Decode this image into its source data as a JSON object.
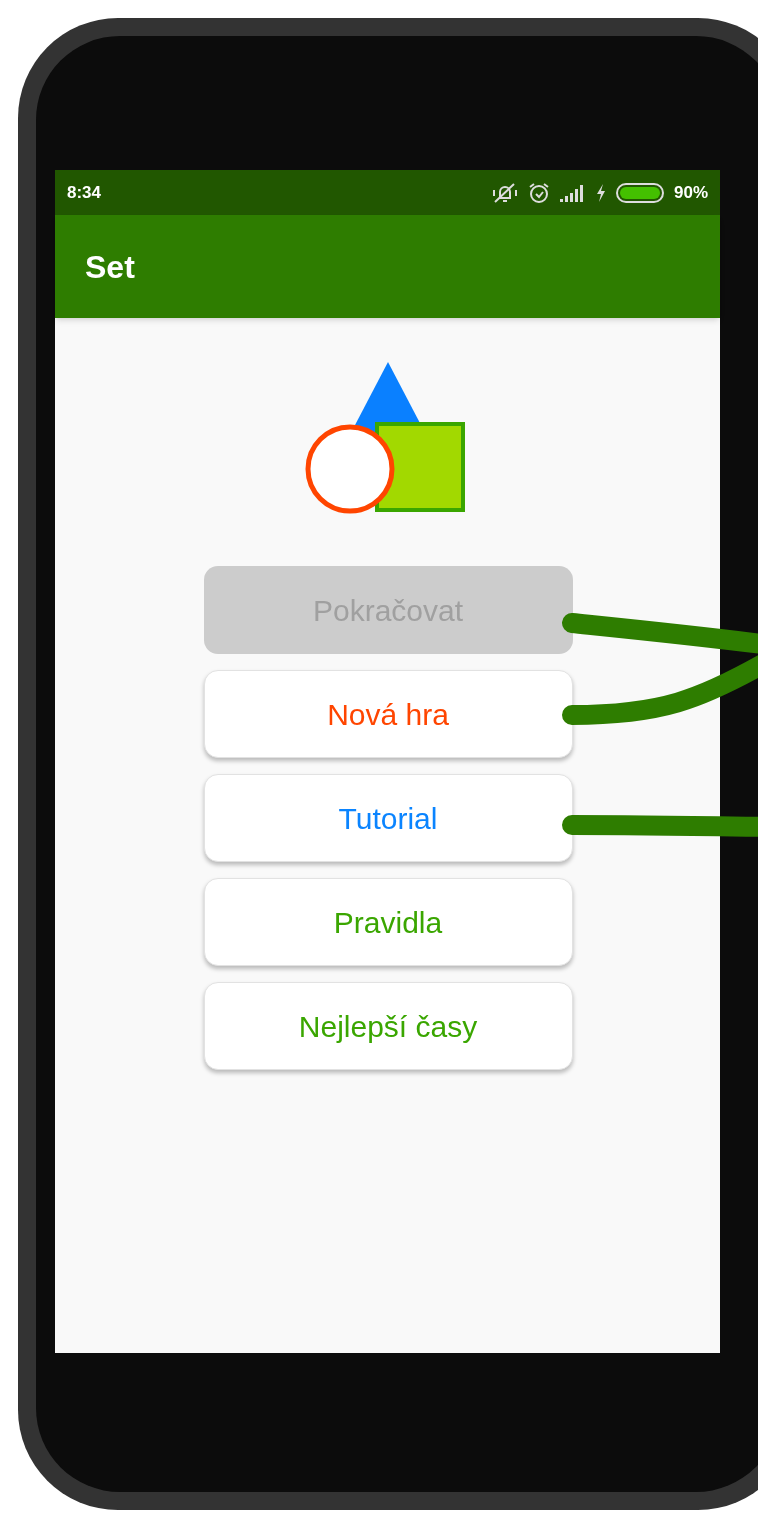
{
  "status_bar": {
    "time": "8:34",
    "battery": "90%"
  },
  "app_bar": {
    "title": "Set"
  },
  "buttons": [
    {
      "label": "Pokračovat",
      "disabled": true,
      "color": "#a0a0a0"
    },
    {
      "label": "Nová hra",
      "disabled": false,
      "color": "#ff4500"
    },
    {
      "label": "Tutorial",
      "disabled": false,
      "color": "#0a84ff"
    },
    {
      "label": "Pravidla",
      "disabled": false,
      "color": "#3aa600"
    },
    {
      "label": "Nejlepší časy",
      "disabled": false,
      "color": "#3aa600"
    }
  ]
}
